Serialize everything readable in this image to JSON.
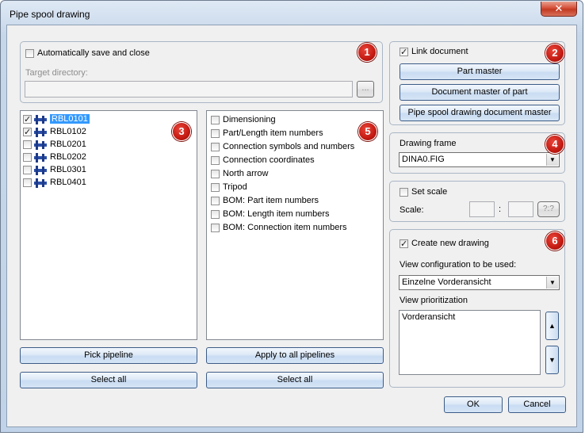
{
  "window": {
    "title": "Pipe spool drawing",
    "close_symbol": "✕"
  },
  "section1": {
    "badge": "1",
    "auto_save_label": "Automatically save and close",
    "auto_save_checked": false,
    "target_directory_label": "Target directory:",
    "target_directory_value": "",
    "browse_label": "..."
  },
  "section2": {
    "badge": "2",
    "link_document_label": "Link document",
    "link_document_checked": true,
    "part_master_label": "Part master",
    "doc_master_part_label": "Document master of part",
    "spool_doc_master_label": "Pipe spool drawing document master"
  },
  "section3": {
    "badge": "3",
    "pipelines": [
      {
        "label": "RBL0101",
        "checked": true,
        "selected": true
      },
      {
        "label": "RBL0102",
        "checked": true,
        "selected": false
      },
      {
        "label": "RBL0201",
        "checked": false,
        "selected": false
      },
      {
        "label": "RBL0202",
        "checked": false,
        "selected": false
      },
      {
        "label": "RBL0301",
        "checked": false,
        "selected": false
      },
      {
        "label": "RBL0401",
        "checked": false,
        "selected": false
      }
    ],
    "pick_pipeline_label": "Pick pipeline",
    "select_all_label": "Select all"
  },
  "section5": {
    "badge": "5",
    "options": [
      "Dimensioning",
      "Part/Length item numbers",
      "Connection symbols and numbers",
      "Connection coordinates",
      "North arrow",
      "Tripod",
      "BOM: Part item numbers",
      "BOM: Length item numbers",
      "BOM: Connection item numbers"
    ],
    "apply_all_label": "Apply to all pipelines",
    "select_all_label": "Select all"
  },
  "section4": {
    "badge": "4",
    "drawing_frame_label": "Drawing frame",
    "drawing_frame_value": "DINA0.FIG"
  },
  "scale": {
    "set_scale_label": "Set scale",
    "set_scale_checked": false,
    "scale_label": "Scale:",
    "separator": ":",
    "ratio_button_label": "?:?"
  },
  "section6": {
    "badge": "6",
    "create_new_label": "Create new drawing",
    "create_new_checked": true,
    "view_config_label": "View configuration to be used:",
    "view_config_value": "Einzelne Vorderansicht",
    "view_priority_label": "View prioritization",
    "view_priority_items": [
      "Vorderansicht"
    ]
  },
  "footer": {
    "ok_label": "OK",
    "cancel_label": "Cancel"
  },
  "colors": {
    "badge": "#c41a12",
    "selection": "#3399ff",
    "button_border": "#3c5c87"
  }
}
